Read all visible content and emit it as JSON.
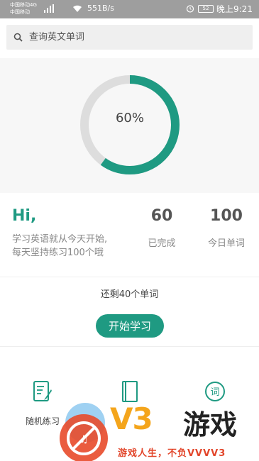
{
  "statusbar": {
    "carrier_1": "中国移动4G",
    "carrier_2": "中国移动",
    "network_speed": "551B/s",
    "battery": "52",
    "time": "晚上9:21"
  },
  "search": {
    "placeholder": "查询英文单词"
  },
  "progress": {
    "percent": 60,
    "label": "60%",
    "color_active": "#1f9a82",
    "color_track": "#dddddd"
  },
  "greeting": {
    "title": "Hi,",
    "line1": "学习英语就从今天开始,",
    "line2": "每天坚持练习100个哦"
  },
  "stats": {
    "completed_value": "60",
    "completed_label": "已完成",
    "daily_value": "100",
    "daily_label": "今日单词"
  },
  "remaining_text": "还剩40个单词",
  "start_button": "开始学习",
  "features": {
    "random_practice": "随机练习",
    "words_icon_text": "词"
  },
  "watermark": {
    "brand_v3": "V3",
    "brand_game": "游戏",
    "slogan": "游戏人生，不负VVVV3"
  },
  "accent_color": "#1f9a82"
}
